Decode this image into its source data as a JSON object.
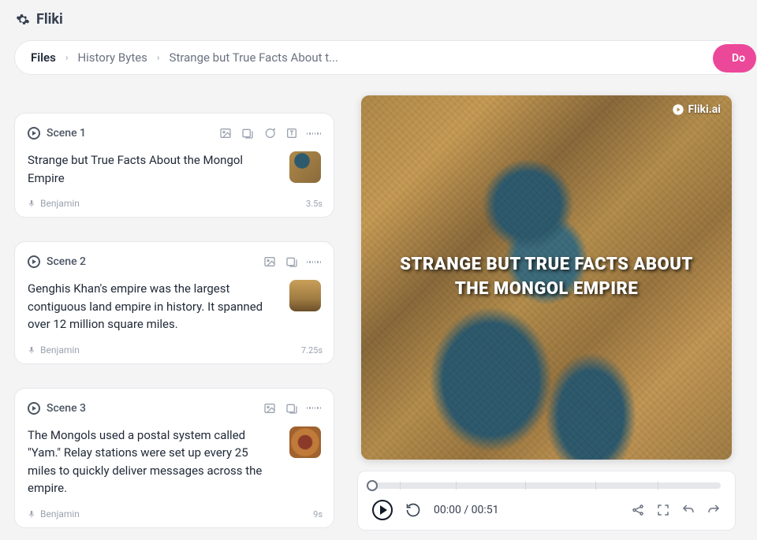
{
  "brand": "Fliki",
  "breadcrumbs": [
    "Files",
    "History Bytes",
    "Strange but True Facts About t..."
  ],
  "download_label": "Do",
  "scenes": [
    {
      "label": "Scene 1",
      "text": "Strange but True Facts About the Mongol Empire",
      "voice": "Benjamin",
      "duration": "3.5s"
    },
    {
      "label": "Scene 2",
      "text": "Genghis Khan's empire was the largest contiguous land empire in history. It spanned over 12 million square miles.",
      "voice": "Benjamin",
      "duration": "7.25s"
    },
    {
      "label": "Scene 3",
      "text": "The Mongols used a postal system called \"Yam.\" Relay stations were set up every 25 miles to quickly deliver messages across the empire.",
      "voice": "Benjamin",
      "duration": "9s"
    }
  ],
  "preview": {
    "watermark": "Fliki.ai",
    "overlay_line1": "STRANGE BUT TRUE FACTS ABOUT",
    "overlay_line2": "THE MONGOL EMPIRE"
  },
  "player": {
    "current_time": "00:00",
    "total_time": "00:51"
  }
}
